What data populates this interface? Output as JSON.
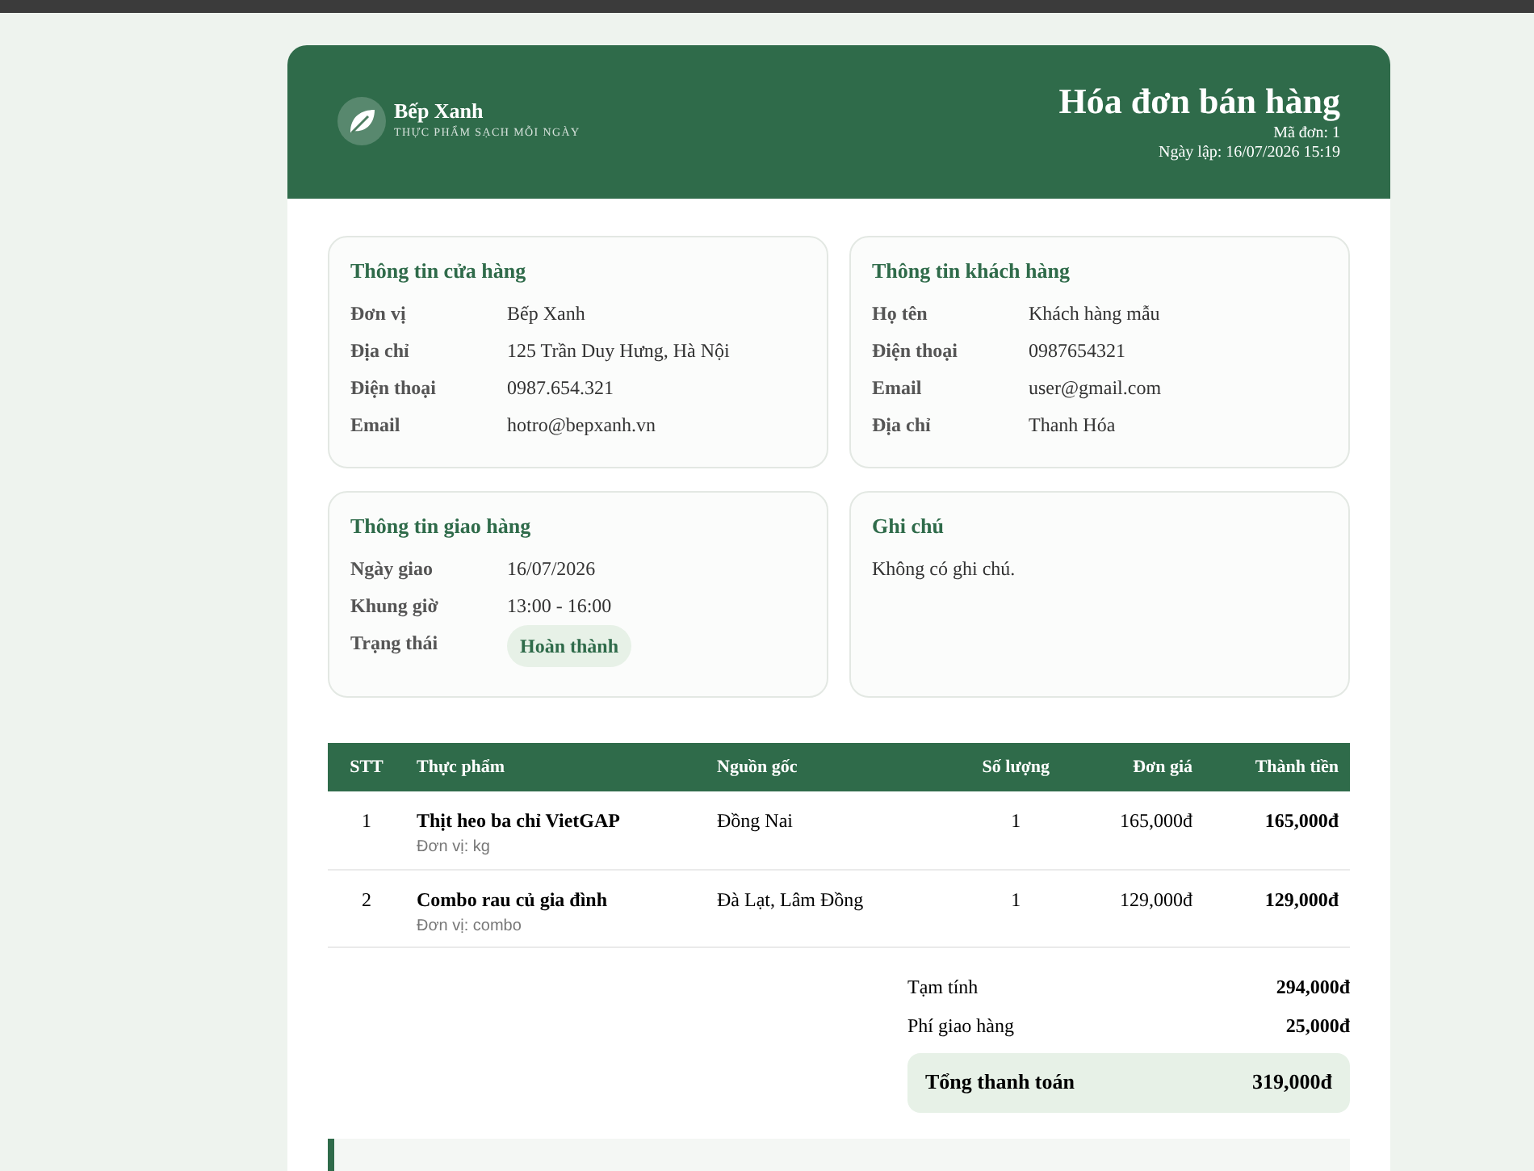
{
  "brand": {
    "name": "Bếp Xanh",
    "tagline": "THỰC PHẨM SẠCH MỖI NGÀY"
  },
  "invoice": {
    "title": "Hóa đơn bán hàng",
    "order_no": "Mã đơn: 1",
    "created": "Ngày lập: 16/07/2026 15:19"
  },
  "store": {
    "title": "Thông tin cửa hàng",
    "rows": [
      {
        "label": "Đơn vị",
        "value": "Bếp Xanh"
      },
      {
        "label": "Địa chỉ",
        "value": "125 Trần Duy Hưng, Hà Nội"
      },
      {
        "label": "Điện thoại",
        "value": "0987.654.321"
      },
      {
        "label": "Email",
        "value": "hotro@bepxanh.vn"
      }
    ]
  },
  "customer": {
    "title": "Thông tin khách hàng",
    "rows": [
      {
        "label": "Họ tên",
        "value": "Khách hàng mẫu"
      },
      {
        "label": "Điện thoại",
        "value": "0987654321"
      },
      {
        "label": "Email",
        "value": "user@gmail.com"
      },
      {
        "label": "Địa chỉ",
        "value": "Thanh Hóa"
      }
    ]
  },
  "delivery": {
    "title": "Thông tin giao hàng",
    "rows": [
      {
        "label": "Ngày giao",
        "value": "16/07/2026",
        "kind": "text"
      },
      {
        "label": "Khung giờ",
        "value": "13:00 - 16:00",
        "kind": "text"
      },
      {
        "label": "Trạng thái",
        "value": "Hoàn thành",
        "kind": "badge"
      }
    ]
  },
  "note": {
    "title": "Ghi chú",
    "text": "Không có ghi chú."
  },
  "table": {
    "columns": [
      "STT",
      "Thực phẩm",
      "Nguồn gốc",
      "Số lượng",
      "Đơn giá",
      "Thành tiền"
    ],
    "rows": [
      {
        "index": "1",
        "name": "Thịt heo ba chỉ VietGAP",
        "unit": "Đơn vị: kg",
        "origin": "Đồng Nai",
        "qty": "1",
        "price": "165,000đ",
        "total": "165,000đ"
      },
      {
        "index": "2",
        "name": "Combo rau củ gia đình",
        "unit": "Đơn vị: combo",
        "origin": "Đà Lạt, Lâm Đồng",
        "qty": "1",
        "price": "129,000đ",
        "total": "129,000đ"
      }
    ]
  },
  "summary": [
    {
      "label": "Tạm tính",
      "value": "294,000đ"
    },
    {
      "label": "Phí giao hàng",
      "value": "25,000đ"
    }
  ],
  "grand_total": {
    "label": "Tổng thanh toán",
    "value": "319,000đ"
  }
}
